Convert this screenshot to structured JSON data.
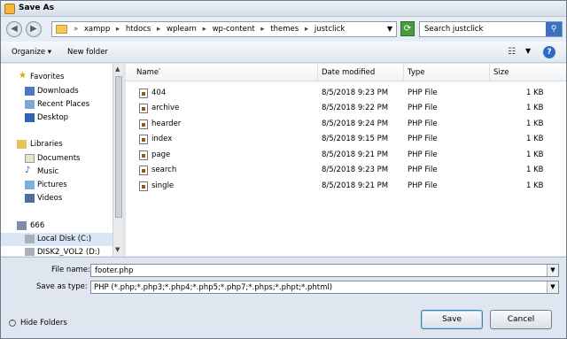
{
  "window": {
    "title": "Save As",
    "icon": "app-icon"
  },
  "address": {
    "breadcrumbs": [
      "xampp",
      "htdocs",
      "wplearn",
      "wp-content",
      "themes",
      "justclick"
    ],
    "search_placeholder": "Search justclick"
  },
  "toolbar": {
    "organize": "Organize ▾",
    "new_folder": "New folder"
  },
  "nav": {
    "favorites_label": "Favorites",
    "favorites": [
      "Downloads",
      "Recent Places",
      "Desktop"
    ],
    "libraries_label": "Libraries",
    "libraries": [
      "Documents",
      "Music",
      "Pictures",
      "Videos"
    ],
    "computer_label": "666",
    "drives": [
      "Local Disk (C:)",
      "DISK2_VOL2 (D:)"
    ]
  },
  "columns": {
    "name": "Name",
    "date": "Date modified",
    "type": "Type",
    "size": "Size"
  },
  "files": [
    {
      "name": "404",
      "date": "8/5/2018 9:23 PM",
      "type": "PHP File",
      "size": "1 KB"
    },
    {
      "name": "archive",
      "date": "8/5/2018 9:22 PM",
      "type": "PHP File",
      "size": "1 KB"
    },
    {
      "name": "hearder",
      "date": "8/5/2018 9:24 PM",
      "type": "PHP File",
      "size": "1 KB"
    },
    {
      "name": "index",
      "date": "8/5/2018 9:15 PM",
      "type": "PHP File",
      "size": "1 KB"
    },
    {
      "name": "page",
      "date": "8/5/2018 9:21 PM",
      "type": "PHP File",
      "size": "1 KB"
    },
    {
      "name": "search",
      "date": "8/5/2018 9:23 PM",
      "type": "PHP File",
      "size": "1 KB"
    },
    {
      "name": "single",
      "date": "8/5/2018 9:21 PM",
      "type": "PHP File",
      "size": "1 KB"
    }
  ],
  "form": {
    "filename_label": "File name:",
    "filename_value": "footer.php",
    "savetype_label": "Save as type:",
    "savetype_value": "PHP (*.php;*.php3;*.php4;*.php5;*.php7;*.phps;*.phpt;*.phtml)"
  },
  "buttons": {
    "hide_folders": "Hide Folders",
    "save": "Save",
    "cancel": "Cancel"
  }
}
